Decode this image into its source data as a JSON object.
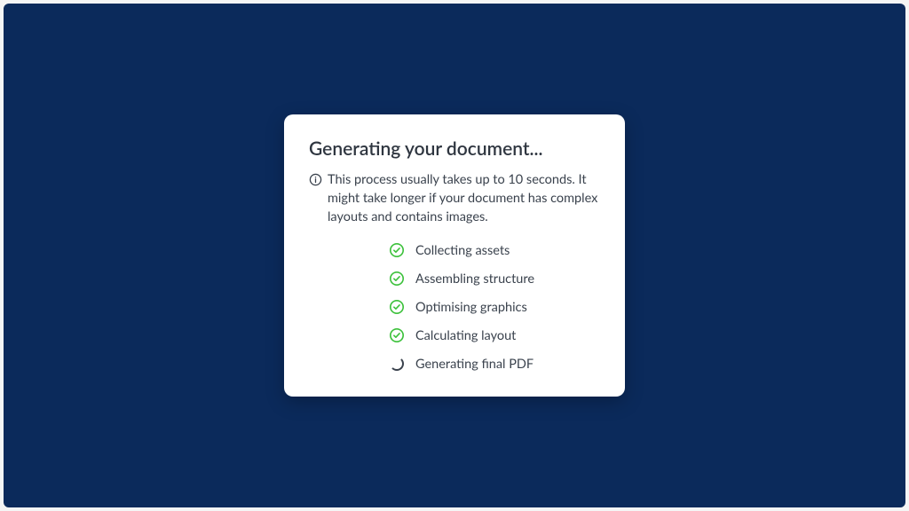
{
  "dialog": {
    "title": "Generating your document...",
    "info_text": "This process usually takes up to 10 seconds. It might take longer if your document has complex layouts and contains images.",
    "steps": [
      {
        "label": "Collecting assets",
        "status": "done"
      },
      {
        "label": "Assembling structure",
        "status": "done"
      },
      {
        "label": "Optimising graphics",
        "status": "done"
      },
      {
        "label": "Calculating layout",
        "status": "done"
      },
      {
        "label": "Generating final PDF",
        "status": "loading"
      }
    ]
  },
  "colors": {
    "backdrop": "#0b2a5b",
    "success": "#3cc13b",
    "text": "#3a424d"
  }
}
